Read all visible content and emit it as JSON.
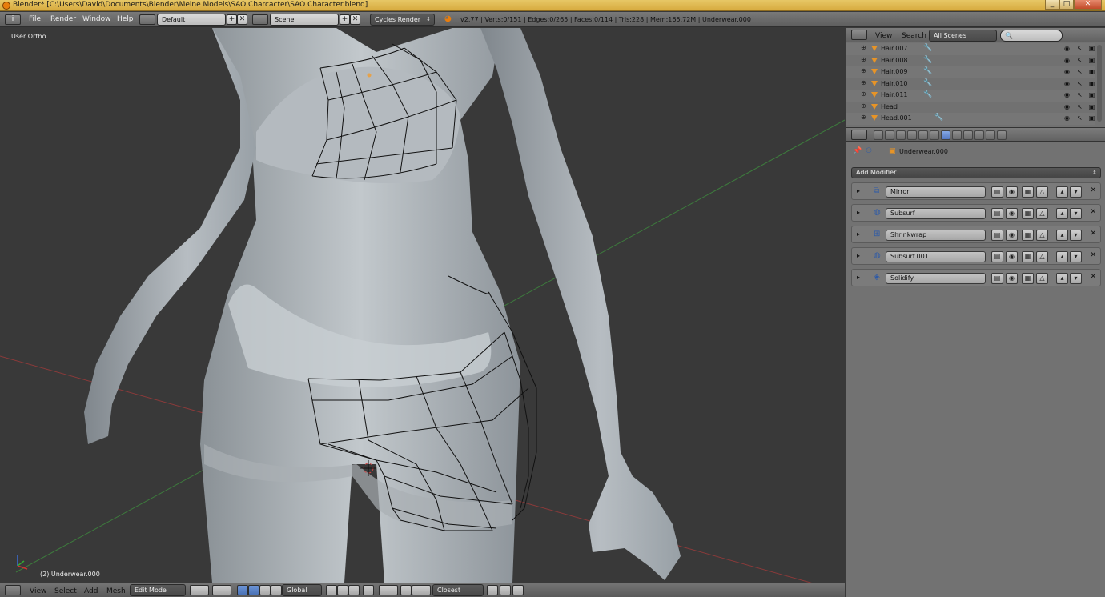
{
  "window": {
    "title": "Blender* [C:\\Users\\David\\Documents\\Blender\\Meine Models\\SAO Charcacter\\SAO Character.blend]",
    "min_glyph": "_",
    "max_glyph": "□",
    "close_glyph": "✕"
  },
  "info_header": {
    "menus": [
      "File",
      "Render",
      "Window",
      "Help"
    ],
    "screen_layout": "Default",
    "scene": "Scene",
    "render_engine": "Cycles Render",
    "stats": "v2.77 | Verts:0/151 | Edges:0/265 | Faces:0/114 | Tris:228 | Mem:165.72M | Underwear.000"
  },
  "viewport": {
    "view_name": "User Ortho",
    "object_label": "(2) Underwear.000"
  },
  "viewport_footer": {
    "menus": [
      "View",
      "Select",
      "Add",
      "Mesh"
    ],
    "mode": "Edit Mode",
    "orientation": "Global",
    "snap_target": "Closest"
  },
  "outliner": {
    "menus": [
      "View",
      "Search"
    ],
    "display_mode": "All Scenes",
    "items": [
      {
        "name": "Hair.007"
      },
      {
        "name": "Hair.008"
      },
      {
        "name": "Hair.009"
      },
      {
        "name": "Hair.010"
      },
      {
        "name": "Hair.011"
      },
      {
        "name": "Head"
      },
      {
        "name": "Head.001"
      }
    ]
  },
  "properties": {
    "object_name": "Underwear.000",
    "add_modifier_label": "Add Modifier",
    "modifiers": [
      {
        "name": "Mirror"
      },
      {
        "name": "Subsurf"
      },
      {
        "name": "Shrinkwrap"
      },
      {
        "name": "Subsurf.001"
      },
      {
        "name": "Solidify"
      }
    ]
  },
  "colors": {
    "title_bar": "#d9ad45",
    "viewport_bg": "#393939",
    "panel_bg": "#727272",
    "active_tab": "#5478c2",
    "object_icon": "#e79427"
  }
}
